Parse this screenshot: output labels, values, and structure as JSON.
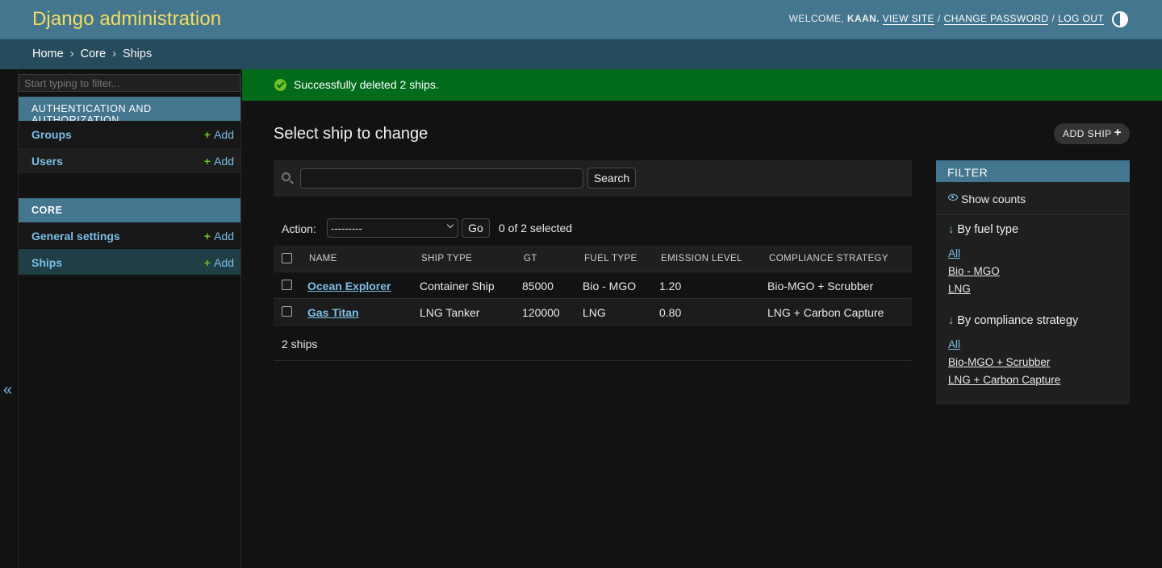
{
  "header": {
    "branding": "Django administration",
    "welcome": "WELCOME,",
    "username": "KAAN.",
    "view_site": "VIEW SITE",
    "change_password": "CHANGE PASSWORD",
    "log_out": "LOG OUT",
    "separator": "/"
  },
  "breadcrumbs": {
    "home": "Home",
    "app": "Core",
    "current": "Ships",
    "arrow": "›"
  },
  "sidebar": {
    "filter_placeholder": "Start typing to filter...",
    "collapse_icon": "«",
    "apps": [
      {
        "name": "AUTHENTICATION AND AUTHORIZATION",
        "models": [
          {
            "name": "Groups",
            "add": "Add"
          },
          {
            "name": "Users",
            "add": "Add"
          }
        ]
      },
      {
        "name": "CORE",
        "models": [
          {
            "name": "General settings",
            "add": "Add"
          },
          {
            "name": "Ships",
            "add": "Add"
          }
        ]
      }
    ],
    "add_plus": "+"
  },
  "message": {
    "text": "Successfully deleted 2 ships."
  },
  "content": {
    "title": "Select ship to change",
    "add_button": "ADD SHIP",
    "add_plus": "+",
    "search": {
      "value": "",
      "button": "Search"
    },
    "actions": {
      "label": "Action:",
      "selected": "---------",
      "go": "Go",
      "counter": "0 of 2 selected"
    },
    "table": {
      "columns": [
        "NAME",
        "SHIP TYPE",
        "GT",
        "FUEL TYPE",
        "EMISSION LEVEL",
        "COMPLIANCE STRATEGY"
      ],
      "rows": [
        [
          "Ocean Explorer",
          "Container Ship",
          "85000",
          "Bio - MGO",
          "1.20",
          "Bio-MGO + Scrubber"
        ],
        [
          "Gas Titan",
          "LNG Tanker",
          "120000",
          "LNG",
          "0.80",
          "LNG + Carbon Capture"
        ]
      ]
    },
    "paginator": "2 ships"
  },
  "filter": {
    "title": "FILTER",
    "show_counts": "Show counts",
    "groups": [
      {
        "title": "By fuel type",
        "options": [
          "All",
          "Bio - MGO",
          "LNG"
        ]
      },
      {
        "title": "By compliance strategy",
        "options": [
          "All",
          "Bio-MGO + Scrubber",
          "LNG + Carbon Capture"
        ]
      }
    ],
    "arrow": "↓"
  },
  "colors": {
    "header_bg": "#44768f",
    "breadcrumbs_bg": "#264b5d",
    "branding": "#f5dd5d",
    "link": "#7cbfe6",
    "success_bg": "#006b1b",
    "add_green": "#70bf2b",
    "page_bg": "#121212"
  },
  "icons": {
    "theme_toggle": "half-circle-contrast-icon",
    "message": "check-circle-icon",
    "search": "search-icon",
    "show_counts": "eye-icon",
    "filter_arrow": "arrow-down-icon"
  }
}
